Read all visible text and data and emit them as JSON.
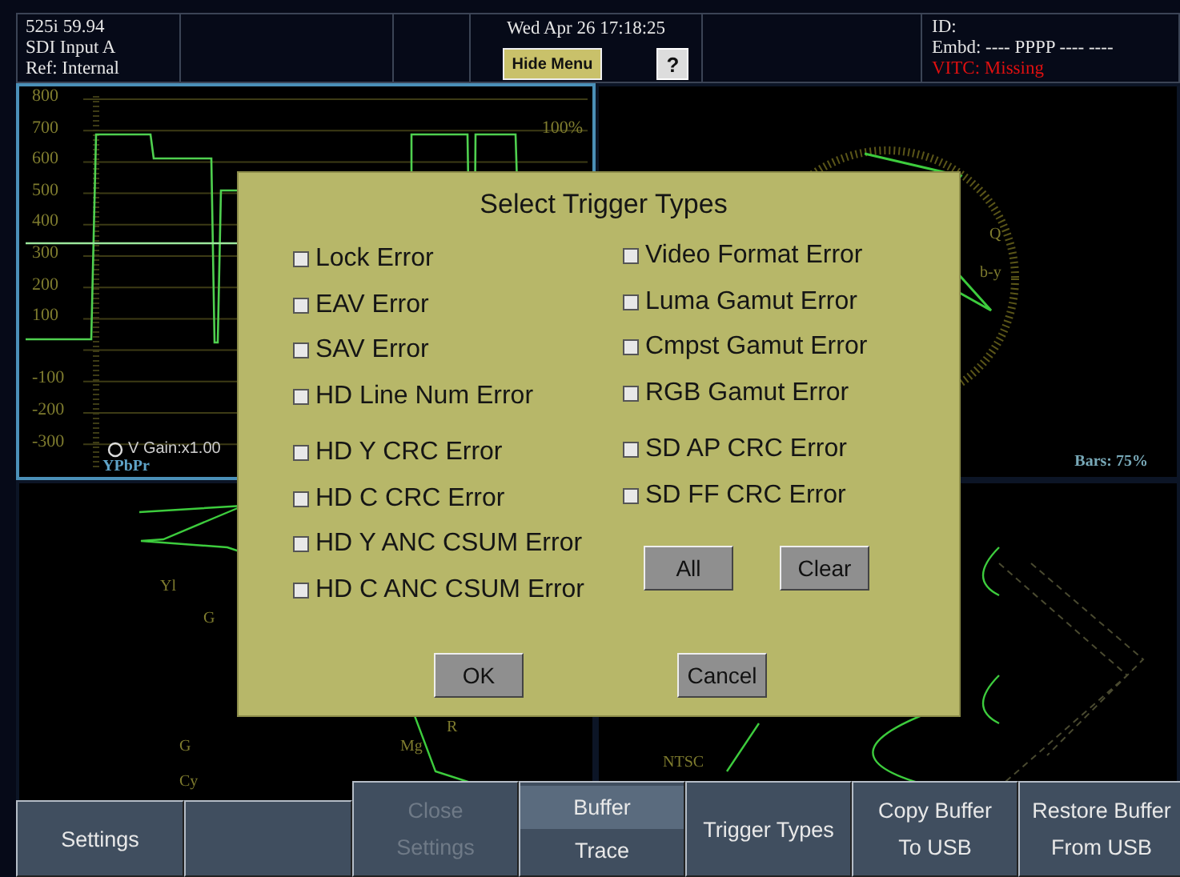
{
  "header": {
    "status_lines": [
      "525i 59.94",
      "SDI Input A",
      "Ref: Internal"
    ],
    "datetime": "Wed Apr 26 17:18:25",
    "hide_menu_button": "Hide Menu",
    "help_button": "?",
    "id_label": "ID:",
    "embd": "Embd: ---- PPPP ---- ----",
    "vitc": "VITC:  Missing"
  },
  "waveform": {
    "scale": [
      "800",
      "700",
      "600",
      "500",
      "400",
      "300",
      "200",
      "100",
      "-100",
      "-200",
      "-300"
    ],
    "percent_label": "100%",
    "gain": "V Gain:x1.00",
    "mode": "YPbPr"
  },
  "vectorscope": {
    "labels": [
      "Q",
      "b-y"
    ],
    "bars": "Bars: 75%"
  },
  "lower_left": {
    "labels": [
      "Yl",
      "G",
      "R",
      "Mg",
      "G",
      "Cy"
    ]
  },
  "lower_right": {
    "label": "NTSC"
  },
  "dialog": {
    "title": "Select Trigger Types",
    "left": [
      {
        "label": "Lock Error",
        "checked": false
      },
      {
        "label": "EAV Error",
        "checked": false
      },
      {
        "label": "SAV Error",
        "checked": false
      },
      {
        "label": "HD Line Num Error",
        "checked": false
      },
      {
        "label": "HD Y CRC Error",
        "checked": false
      },
      {
        "label": "HD C CRC Error",
        "checked": false
      },
      {
        "label": "HD Y ANC CSUM Error",
        "checked": false
      },
      {
        "label": "HD C ANC CSUM Error",
        "checked": false
      }
    ],
    "right": [
      {
        "label": "Video Format Error",
        "checked": false
      },
      {
        "label": "Luma Gamut Error",
        "checked": false
      },
      {
        "label": "Cmpst Gamut Error",
        "checked": false
      },
      {
        "label": "RGB Gamut Error",
        "checked": false
      },
      {
        "label": "SD AP CRC Error",
        "checked": false
      },
      {
        "label": "SD FF CRC Error",
        "checked": false
      }
    ],
    "select_buttons": [
      "All",
      "Clear"
    ],
    "actions": [
      "OK",
      "Cancel"
    ]
  },
  "menu": [
    {
      "kind": "button",
      "lines": [
        "Settings"
      ],
      "disabled": false
    },
    {
      "kind": "blank"
    },
    {
      "kind": "button",
      "lines": [
        "Close",
        "Settings"
      ],
      "disabled": true
    },
    {
      "kind": "toggle",
      "options": [
        {
          "label": "Buffer",
          "selected": true
        },
        {
          "label": "Trace",
          "selected": false
        }
      ]
    },
    {
      "kind": "button",
      "lines": [
        "Trigger Types"
      ],
      "disabled": false
    },
    {
      "kind": "button",
      "lines": [
        "Copy Buffer",
        "To USB"
      ],
      "disabled": false
    },
    {
      "kind": "button",
      "lines": [
        "Restore Buffer",
        "From USB"
      ],
      "disabled": false
    }
  ]
}
